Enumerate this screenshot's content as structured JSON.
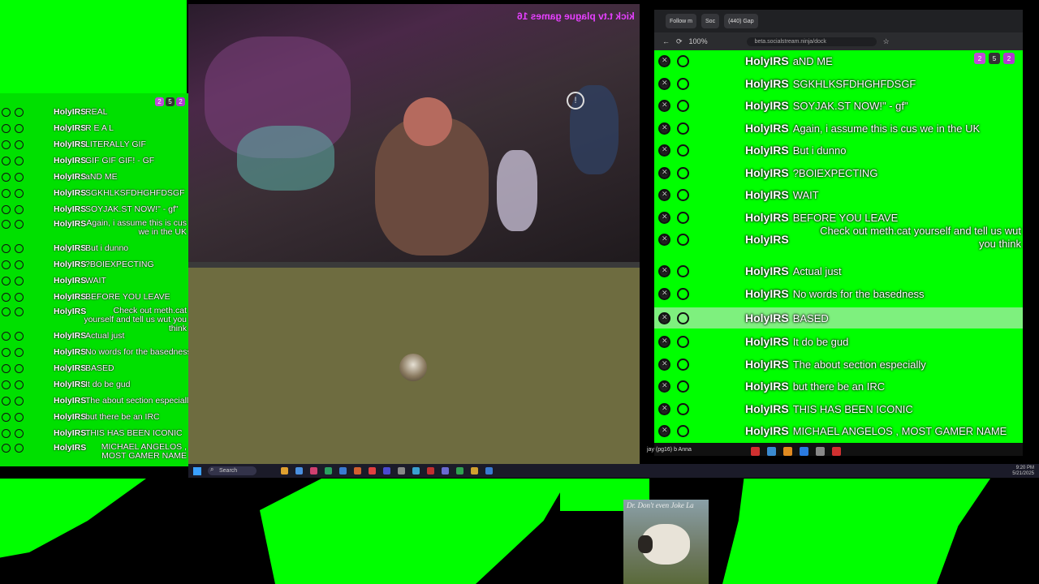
{
  "left_chat": {
    "messages": [
      {
        "user": "HolyIRS",
        "text": "REAL"
      },
      {
        "user": "HolyIRS",
        "text": "R E A L"
      },
      {
        "user": "HolyIRS",
        "text": "LITERALLY GIF"
      },
      {
        "user": "HolyIRS",
        "text": "GIF GIF GIF! - GF"
      },
      {
        "user": "HolyIRS",
        "text": "aND ME"
      },
      {
        "user": "HolyIRS",
        "text": "SGKHLKSFDHGHFDSGF"
      },
      {
        "user": "HolyIRS",
        "text": "SOYJAK.ST NOW!\" - gf\""
      },
      {
        "user": "HolyIRS",
        "text": "Again, i assume this is cus we in the UK"
      },
      {
        "user": "HolyIRS",
        "text": "But i dunno"
      },
      {
        "user": "HolyIRS",
        "text": "?BOIEXPECTING"
      },
      {
        "user": "HolyIRS",
        "text": "WAIT"
      },
      {
        "user": "HolyIRS",
        "text": "BEFORE YOU LEAVE"
      },
      {
        "user": "HolyIRS",
        "text": "Check out meth.cat yourself and tell us wut you think"
      },
      {
        "user": "HolyIRS",
        "text": "Actual just"
      },
      {
        "user": "HolyIRS",
        "text": "No words for the basedness"
      },
      {
        "user": "HolyIRS",
        "text": "BASED"
      },
      {
        "user": "HolyIRS",
        "text": "It do be gud"
      },
      {
        "user": "HolyIRS",
        "text": "The about section especially"
      },
      {
        "user": "HolyIRS",
        "text": "but there be an IRC"
      },
      {
        "user": "HolyIRS",
        "text": "THIS HAS BEEN ICONIC"
      },
      {
        "user": "HolyIRS",
        "text": "MICHAEL ANGELOS , MOST GAMER NAME"
      }
    ],
    "badges": [
      "2",
      "5",
      "2"
    ]
  },
  "stream": {
    "overlay_text": "kick t.tv plague games 16"
  },
  "browser": {
    "tabs": [
      "Follow m",
      "Soc",
      "(440) Gap"
    ],
    "url": "beta.socialstream.ninja/dock",
    "zoom": "100%",
    "chat_badges": [
      "2",
      "5",
      "2"
    ],
    "messages": [
      {
        "user": "HolyIRS",
        "text": "aND ME"
      },
      {
        "user": "HolyIRS",
        "text": "SGKHLKSFDHGHFDSGF"
      },
      {
        "user": "HolyIRS",
        "text": "SOYJAK.ST NOW!\" - gf\""
      },
      {
        "user": "HolyIRS",
        "text": "Again, i assume this is cus we in the UK"
      },
      {
        "user": "HolyIRS",
        "text": "But i dunno"
      },
      {
        "user": "HolyIRS",
        "text": "?BOIEXPECTING"
      },
      {
        "user": "HolyIRS",
        "text": "WAIT"
      },
      {
        "user": "HolyIRS",
        "text": "BEFORE YOU LEAVE"
      },
      {
        "user": "HolyIRS",
        "text": "Check out meth.cat yourself and tell us wut you think"
      },
      {
        "user": "HolyIRS",
        "text": "Actual just"
      },
      {
        "user": "HolyIRS",
        "text": "No words for the basedness"
      },
      {
        "user": "HolyIRS",
        "text": "BASED",
        "highlighted": true
      },
      {
        "user": "HolyIRS",
        "text": "It do be gud"
      },
      {
        "user": "HolyIRS",
        "text": "The about section especially"
      },
      {
        "user": "HolyIRS",
        "text": "but there be an IRC"
      },
      {
        "user": "HolyIRS",
        "text": "THIS HAS BEEN ICONIC"
      },
      {
        "user": "HolyIRS",
        "text": "MICHAEL ANGELOS , MOST GAMER NAME"
      }
    ],
    "status_line": "jay (pg16) b Anna"
  },
  "taskbar": {
    "search_placeholder": "Search",
    "clock_time": "9:20 PM",
    "clock_date": "5/21/2025"
  },
  "sheep_card": {
    "caption": "Dr. Don't even Joke La"
  },
  "colors": {
    "chroma_green": "#00ff00",
    "highlight_row": "#7ef07e",
    "kick_text": "#e640ff"
  }
}
